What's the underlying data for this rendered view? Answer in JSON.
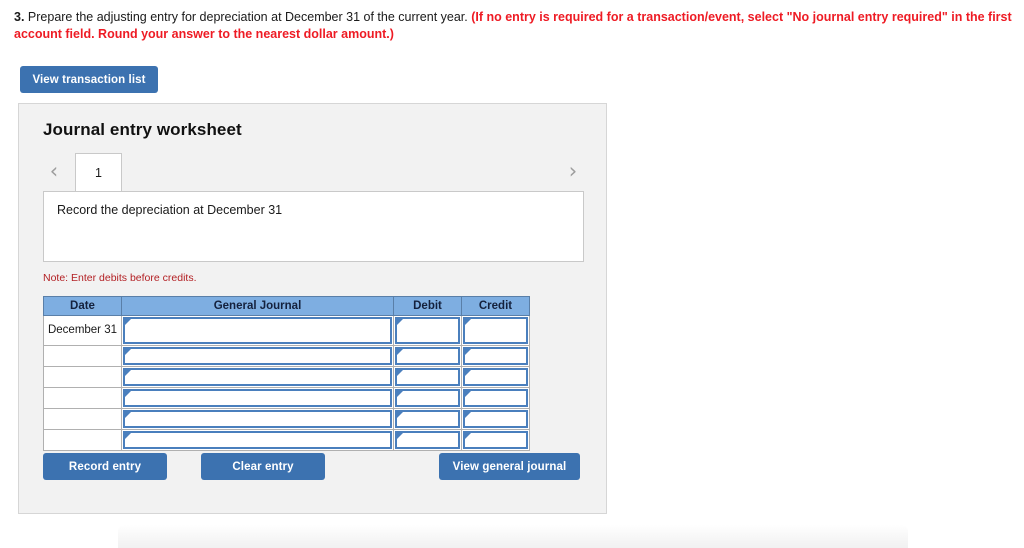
{
  "prompt": {
    "number": "3.",
    "main": " Prepare the adjusting entry for depreciation at December 31 of the current year. ",
    "emphasis": "(If no entry is required for a transaction/event, select \"No journal entry required\" in the first account field. Round your answer to the nearest dollar amount.)"
  },
  "toolbar": {
    "view_transaction_list_label": "View transaction list"
  },
  "panel": {
    "title": "Journal entry worksheet",
    "tabs": {
      "prev_icon": "chevron-left-icon",
      "next_icon": "chevron-right-icon",
      "prev_glyph": "‹",
      "next_glyph": "›",
      "items": [
        {
          "label": "1",
          "active": true
        }
      ]
    },
    "description": "Record the depreciation at December 31",
    "note": "Note: Enter debits before credits.",
    "table": {
      "columns": [
        "Date",
        "General Journal",
        "Debit",
        "Credit"
      ],
      "rows": [
        {
          "date": "December 31",
          "general_journal": "",
          "debit": "",
          "credit": ""
        },
        {
          "date": "",
          "general_journal": "",
          "debit": "",
          "credit": ""
        },
        {
          "date": "",
          "general_journal": "",
          "debit": "",
          "credit": ""
        },
        {
          "date": "",
          "general_journal": "",
          "debit": "",
          "credit": ""
        },
        {
          "date": "",
          "general_journal": "",
          "debit": "",
          "credit": ""
        },
        {
          "date": "",
          "general_journal": "",
          "debit": "",
          "credit": ""
        }
      ]
    },
    "actions": {
      "record_entry_label": "Record entry",
      "clear_entry_label": "Clear entry",
      "view_general_journal_label": "View general journal"
    }
  },
  "colors": {
    "button_blue": "#3c72b0",
    "table_header_blue": "#7eaee1",
    "field_border_blue": "#4a7fbd",
    "panel_background": "#f2f2f2",
    "note_red": "#b32024",
    "emphasis_red": "#ee1b24"
  }
}
